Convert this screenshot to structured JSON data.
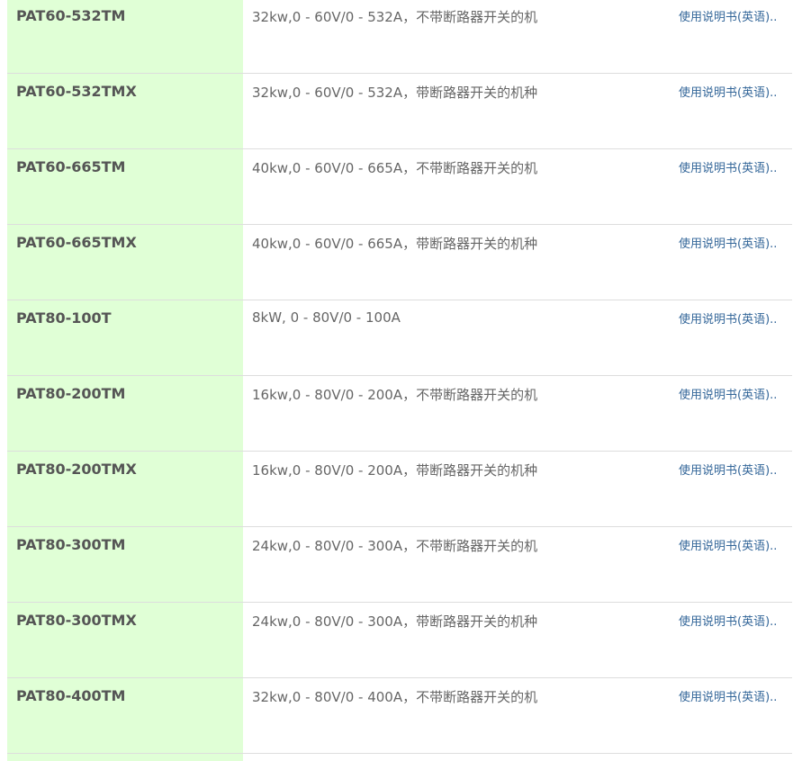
{
  "rows": [
    {
      "model": "PAT60-532TM",
      "desc": "32kw,0 - 60V/0 - 532A，不带断路器开关的机",
      "link": "使用说明书(英语).."
    },
    {
      "model": "PAT60-532TMX",
      "desc": "32kw,0 - 60V/0 - 532A，带断路器开关的机种",
      "link": "使用说明书(英语).."
    },
    {
      "model": "PAT60-665TM",
      "desc": "40kw,0 - 60V/0 - 665A，不带断路器开关的机",
      "link": "使用说明书(英语).."
    },
    {
      "model": "PAT60-665TMX",
      "desc": "40kw,0 - 60V/0 - 665A，带断路器开关的机种",
      "link": "使用说明书(英语).."
    },
    {
      "model": "PAT80-100T",
      "desc": "8kW, 0 - 80V/0 - 100A",
      "link": "使用说明书(英语).."
    },
    {
      "model": "PAT80-200TM",
      "desc": "16kw,0 - 80V/0 - 200A，不带断路器开关的机",
      "link": "使用说明书(英语).."
    },
    {
      "model": "PAT80-200TMX",
      "desc": "16kw,0 - 80V/0 - 200A，带断路器开关的机种",
      "link": "使用说明书(英语).."
    },
    {
      "model": "PAT80-300TM",
      "desc": "24kw,0 - 80V/0 - 300A，不带断路器开关的机",
      "link": "使用说明书(英语).."
    },
    {
      "model": "PAT80-300TMX",
      "desc": "24kw,0 - 80V/0 - 300A，带断路器开关的机种",
      "link": "使用说明书(英语).."
    },
    {
      "model": "PAT80-400TM",
      "desc": "32kw,0 - 80V/0 - 400A，不带断路器开关的机",
      "link": "使用说明书(英语).."
    }
  ]
}
